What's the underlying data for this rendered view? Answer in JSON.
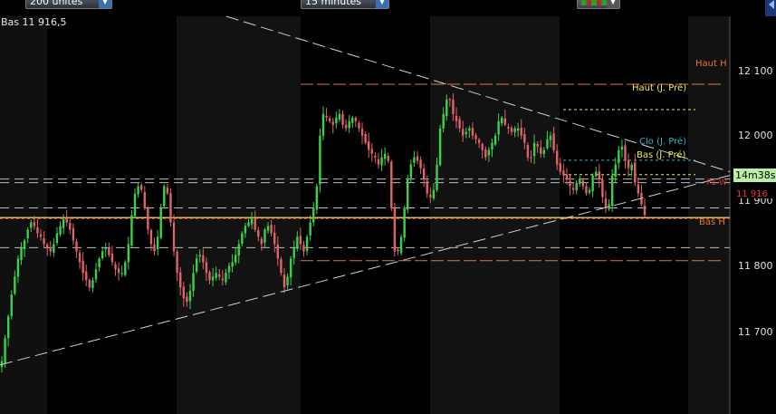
{
  "toolbar": {
    "units_value": "200 unités",
    "interval_value": "15 minutes"
  },
  "info": {
    "low_text": "Bas 11 916,5"
  },
  "axis": {
    "price_ticks": [
      "12 100",
      "12 000",
      "11 900",
      "11 800",
      "11 700"
    ]
  },
  "annotations": {
    "haut_h": "Haut H",
    "bas_h": "Bas H",
    "haut_prev": "Haut (J. Pré)",
    "bas_prev": "Bas (J. Pré)",
    "clo_prev": "Clo (J. Pré)",
    "pivot": "P1 W",
    "timer": "14m38s",
    "current_price": "11 916"
  },
  "colors": {
    "background": "#000000",
    "band": "#121212",
    "up_candle": "#3bd14a",
    "down_candle": "#e0626b",
    "high_low_line": "#e8743a",
    "prev_day_line": "#f2ee57",
    "close_prev_line": "#33b6c8",
    "pivot_line": "#d83030",
    "price_line": "#d9c23a",
    "trend_line": "#cfcfcf",
    "timer_bg": "#b9f0a6"
  },
  "chart_data": {
    "type": "candlestick",
    "y_unit": "index points",
    "ylim": [
      11645,
      12195
    ],
    "y_ticks": [
      12100,
      12000,
      11900,
      11800,
      11700
    ],
    "levels": {
      "haut_h": 12101,
      "bas_h": 11857,
      "haut_prev": 12066,
      "bas_prev": 11976,
      "clo_prev": 11996,
      "pivot_w": 11915,
      "current": 11916.5,
      "dashed_levels": [
        11970,
        11965,
        11930,
        11875
      ]
    },
    "trendlines": [
      {
        "from": [
          0.31,
          12195
        ],
        "to": [
          1.0,
          11980
        ]
      },
      {
        "from": [
          0.0,
          11713
        ],
        "to": [
          1.0,
          11975
        ]
      }
    ],
    "close_series": [
      11718,
      11750,
      11780,
      11810,
      11835,
      11860,
      11875,
      11885,
      11900,
      11910,
      11905,
      11895,
      11890,
      11880,
      11875,
      11870,
      11880,
      11895,
      11905,
      11915,
      11910,
      11900,
      11885,
      11870,
      11855,
      11840,
      11830,
      11820,
      11830,
      11845,
      11860,
      11870,
      11875,
      11865,
      11855,
      11845,
      11840,
      11840,
      11855,
      11880,
      11920,
      11950,
      11960,
      11955,
      11930,
      11900,
      11880,
      11870,
      11890,
      11930,
      11960,
      11950,
      11910,
      11870,
      11840,
      11820,
      11805,
      11800,
      11815,
      11840,
      11860,
      11865,
      11855,
      11840,
      11830,
      11835,
      11840,
      11835,
      11830,
      11840,
      11850,
      11855,
      11865,
      11880,
      11895,
      11905,
      11910,
      11915,
      11900,
      11890,
      11880,
      11900,
      11905,
      11895,
      11880,
      11860,
      11840,
      11820,
      11835,
      11860,
      11875,
      11890,
      11880,
      11870,
      11890,
      11910,
      11930,
      11960,
      12030,
      12060,
      12055,
      12050,
      12045,
      12055,
      12060,
      12045,
      12040,
      12050,
      12055,
      12050,
      12040,
      12030,
      12020,
      12010,
      12005,
      12000,
      11990,
      12000,
      12005,
      11995,
      11930,
      11870,
      11870,
      11890,
      11930,
      11970,
      11990,
      12000,
      11995,
      11985,
      11970,
      11950,
      11945,
      11955,
      11990,
      12040,
      12060,
      12080,
      12080,
      12060,
      12050,
      12040,
      12030,
      12035,
      12040,
      12030,
      12025,
      12020,
      12010,
      12000,
      12010,
      12020,
      12030,
      12050,
      12055,
      12045,
      12040,
      12035,
      12040,
      12040,
      12030,
      12020,
      12000,
      12000,
      12020,
      12015,
      12005,
      12010,
      12025,
      12030,
      12010,
      11990,
      11980,
      11975,
      11970,
      11960,
      11955,
      11965,
      11970,
      11960,
      11950,
      11955,
      11975,
      11980,
      11970,
      11945,
      11930,
      11935,
      11975,
      11990,
      12010,
      12015,
      11995,
      11985,
      11990,
      11965,
      11950,
      11935,
      11920
    ]
  }
}
